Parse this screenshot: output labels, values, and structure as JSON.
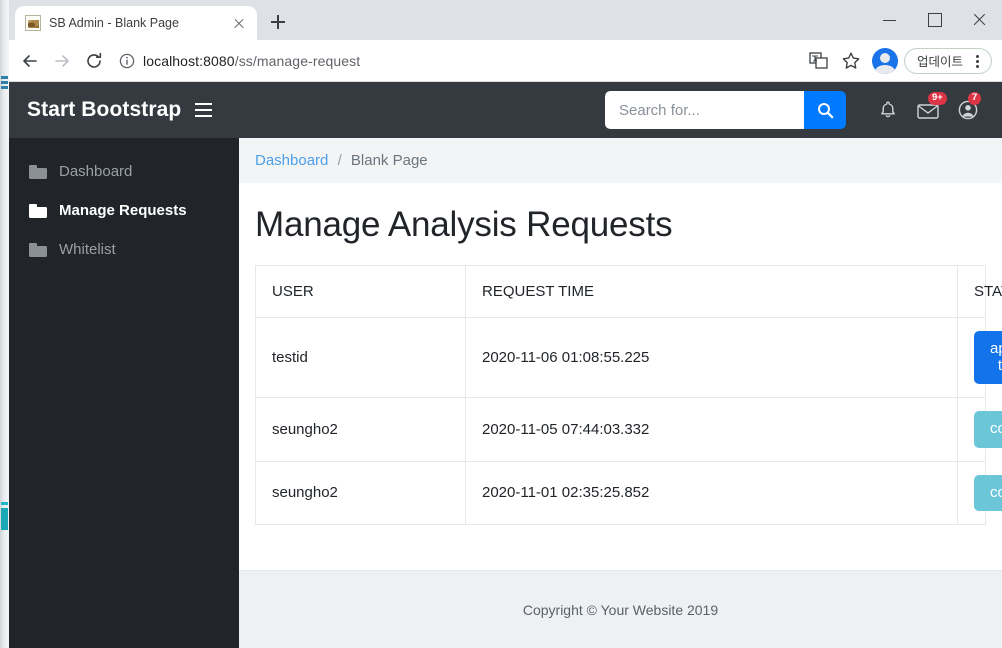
{
  "browser": {
    "tab": {
      "title": "SB Admin - Blank Page",
      "favicon_name": "site-favicon",
      "close_label": "×"
    },
    "new_tab_label": "+",
    "window_controls": {
      "minimize": "—",
      "maximize": "□",
      "close": "×"
    },
    "toolbar": {
      "back_label": "Back",
      "forward_label": "Forward",
      "reload_label": "Reload",
      "url_host": "localhost:8080",
      "url_path": "/ss/manage-request",
      "translate_label": "Translate",
      "bookmark_label": "Bookmark this tab",
      "profile_label": "Profile",
      "update_label": "업데이트",
      "menu_label": "Customize and control Google Chrome"
    }
  },
  "topbar": {
    "brand": "Start Bootstrap",
    "search": {
      "placeholder": "Search for...",
      "value": ""
    },
    "alerts_badge": "",
    "messages_badge": "9+",
    "user_badge": "7"
  },
  "sidebar": {
    "items": [
      {
        "label": "Dashboard",
        "active": false
      },
      {
        "label": "Manage Requests",
        "active": true
      },
      {
        "label": "Whitelist",
        "active": false
      }
    ]
  },
  "main": {
    "breadcrumb": {
      "link": "Dashboard",
      "separator": "/",
      "current": "Blank Page"
    },
    "page_title": "Manage Analysis Requests",
    "table": {
      "columns": [
        "USER",
        "REQUEST TIME",
        "STATUS"
      ],
      "rows": [
        {
          "user": "testid",
          "request_time": "2020-11-06 01:08:55.225",
          "status_label": "approve to run",
          "status_variant": "primary"
        },
        {
          "user": "seungho2",
          "request_time": "2020-11-05 07:44:03.332",
          "status_label": "complete",
          "status_variant": "info"
        },
        {
          "user": "seungho2",
          "request_time": "2020-11-01 02:35:25.852",
          "status_label": "complete",
          "status_variant": "info"
        }
      ]
    }
  },
  "footer": {
    "copyright": "Copyright © Your Website 2019"
  },
  "colors": {
    "topbar_bg": "#343a40",
    "sidebar_bg": "#212529",
    "accent_blue": "#007bff",
    "btn_primary": "#1273ea",
    "btn_info": "#6bc6d8",
    "badge_red": "#dc3545",
    "breadcrumb_link": "#4d9fe8"
  }
}
